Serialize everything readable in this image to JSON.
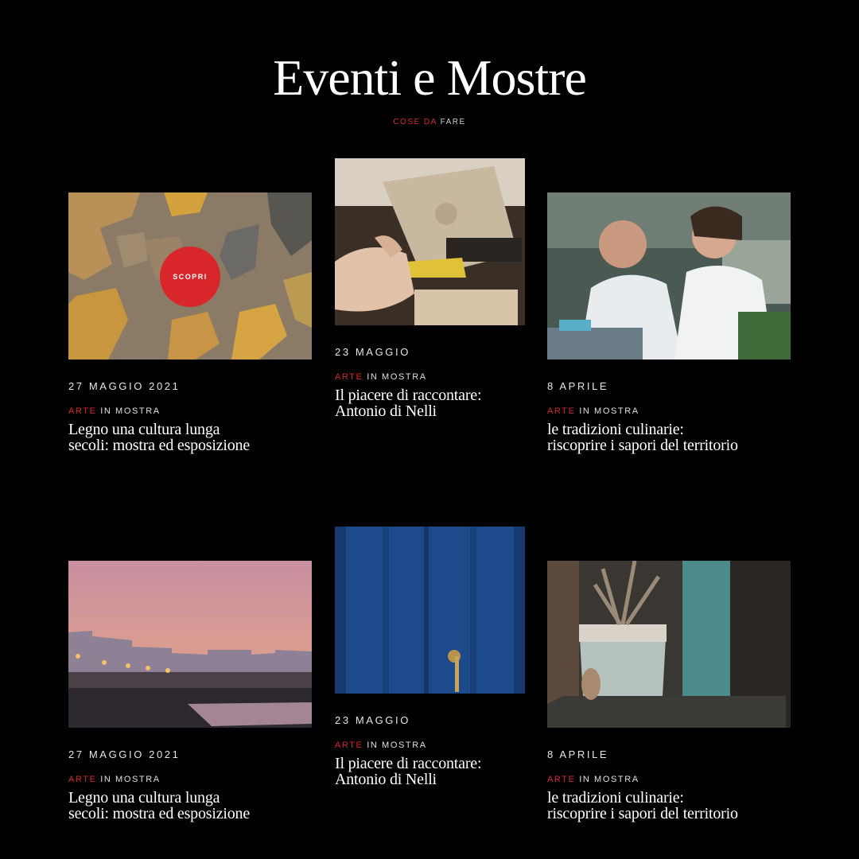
{
  "header": {
    "title": "Eventi e Mostre",
    "breadcrumb_accent": "COSE DA",
    "breadcrumb_rest": "FARE"
  },
  "colors": {
    "background": "#000000",
    "accent": "#d42a2a"
  },
  "cards": [
    {
      "image": "bark-texture-image",
      "date": "27 MAGGIO 2021",
      "category_accent": "ARTE",
      "category_rest": "IN MOSTRA",
      "title": "Legno una cultura lunga secoli: mostra ed esposizione",
      "overlay_button": "SCOPRI"
    },
    {
      "image": "craft-workshop-image",
      "date": "23 MAGGIO",
      "category_accent": "ARTE",
      "category_rest": "IN MOSTRA",
      "title": "Il piacere di raccontare: Antonio di Nelli"
    },
    {
      "image": "chefs-cooking-image",
      "date": "8 APRILE",
      "category_accent": "ARTE",
      "category_rest": "IN MOSTRA",
      "title": "le tradizioni culinarie: riscoprire i sapori del territorio"
    },
    {
      "image": "coastal-town-sunset-image",
      "date": "27 MAGGIO 2021",
      "category_accent": "ARTE",
      "category_rest": "IN MOSTRA",
      "title": "Legno una cultura lunga secoli: mostra ed esposizione"
    },
    {
      "image": "blue-door-image",
      "date": "23 MAGGIO",
      "category_accent": "ARTE",
      "category_rest": "IN MOSTRA",
      "title": "Il piacere di raccontare: Antonio di Nelli"
    },
    {
      "image": "potted-plant-image",
      "date": "8 APRILE",
      "category_accent": "ARTE",
      "category_rest": "IN MOSTRA",
      "title": "le tradizioni culinarie: riscoprire i sapori del territorio"
    }
  ]
}
